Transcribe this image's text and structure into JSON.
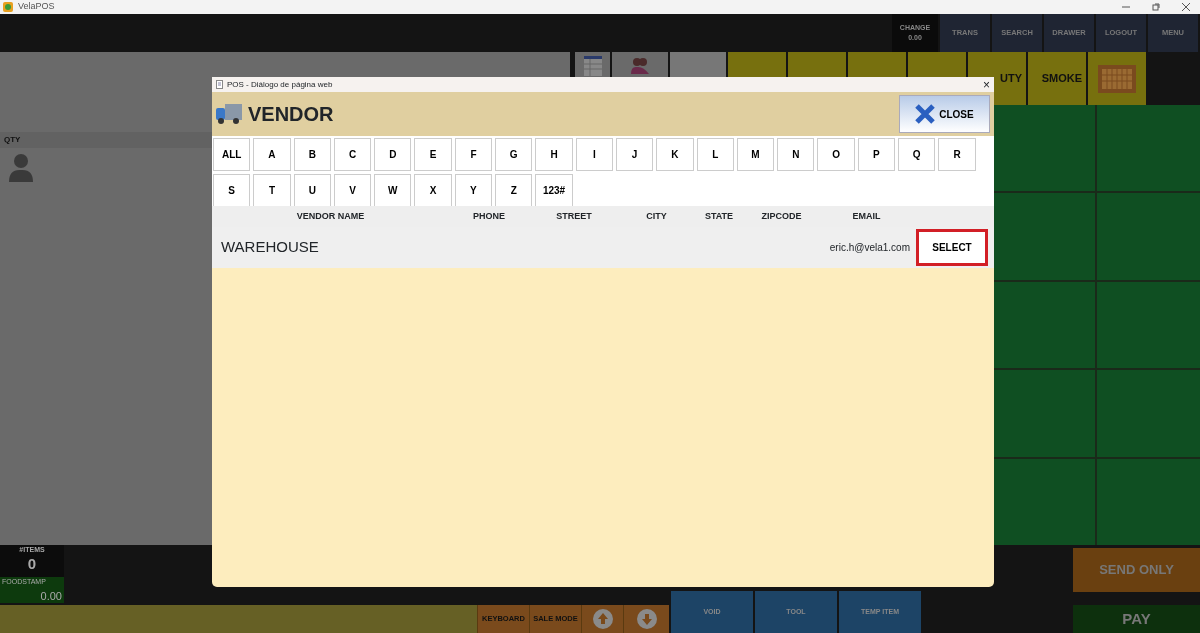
{
  "window": {
    "title": "VelaPOS"
  },
  "top_bar": {
    "change_label": "CHANGE",
    "change_value": "0.00",
    "buttons": [
      "TRANS",
      "SEARCH",
      "DRAWER",
      "LOGOUT",
      "MENU"
    ]
  },
  "left_panel": {
    "qty_label": "QTY"
  },
  "categories": [
    {
      "kind": "table"
    },
    {
      "kind": "people"
    },
    {
      "kind": "gray"
    },
    {
      "kind": "olive"
    },
    {
      "kind": "olive"
    },
    {
      "kind": "olive"
    },
    {
      "kind": "olive"
    },
    {
      "kind": "olive",
      "label": "UTY"
    },
    {
      "kind": "olive",
      "label": "SMOKE"
    },
    {
      "kind": "keyboard"
    }
  ],
  "totals": {
    "items_label": "#ITEMS",
    "items_value": "0",
    "foodstamp_label": "FOODSTAMP",
    "foodstamp_value": "0.00"
  },
  "bottom_buttons": [
    {
      "kind": "text",
      "label": "KEYBOARD"
    },
    {
      "kind": "text",
      "label": "SALE MODE"
    },
    {
      "kind": "up"
    },
    {
      "kind": "down"
    }
  ],
  "action_buttons": [
    "VOID",
    "TOOL",
    "TEMP ITEM"
  ],
  "pay_buttons": [
    "SEND ONLY",
    "PAY"
  ],
  "dialog": {
    "title": "POS - Diálogo de página web",
    "close_symbol": "×",
    "heading": "VENDOR",
    "close_label": "CLOSE",
    "letters": [
      "ALL",
      "A",
      "B",
      "C",
      "D",
      "E",
      "F",
      "G",
      "H",
      "I",
      "J",
      "K",
      "L",
      "M",
      "N",
      "O",
      "P",
      "Q",
      "R",
      "S",
      "T",
      "U",
      "V",
      "W",
      "X",
      "Y",
      "Z",
      "123#"
    ],
    "columns": [
      "VENDOR NAME",
      "PHONE",
      "STREET",
      "CITY",
      "STATE",
      "ZIPCODE",
      "EMAIL"
    ],
    "rows": [
      {
        "vendor_name": "WAREHOUSE",
        "email": "eric.h@vela1.com",
        "action": "SELECT",
        "highlighted": true
      }
    ]
  }
}
